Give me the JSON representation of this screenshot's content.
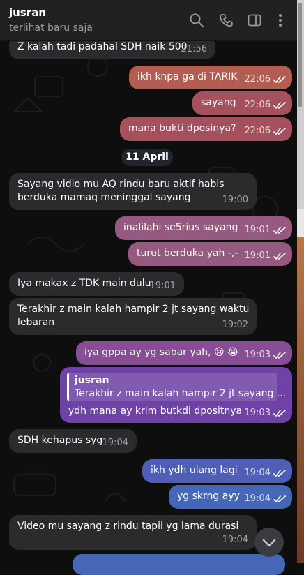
{
  "header": {
    "contact_name": "jusran",
    "status": "terlihat baru saja"
  },
  "date_separator": "11 April",
  "messages": [
    {
      "text": "Z kalah tadi padahal SDH naik 500",
      "time": "21:56",
      "dir": "in"
    },
    {
      "text": "ikh knpa ga di TARIK",
      "time": "22:06",
      "dir": "out"
    },
    {
      "text": "sayang",
      "time": "22:06",
      "dir": "out"
    },
    {
      "text": "mana bukti dposinya?",
      "time": "22:06",
      "dir": "out"
    },
    {
      "text": "Sayang vidio mu AQ rindu baru aktif habis\nberduka mamaq meninggal sayang",
      "time": "19:00",
      "dir": "in"
    },
    {
      "text": "inalilahi se5rius sayang",
      "time": "19:01",
      "dir": "out"
    },
    {
      "text": "turut berduka yah -,-",
      "time": "19:01",
      "dir": "out"
    },
    {
      "text": "Iya makax z TDK main dulu",
      "time": "19:01",
      "dir": "in"
    },
    {
      "text": "Terakhir z main kalah hampir 2 jt sayang waktu\nlebaran",
      "time": "19:02",
      "dir": "in"
    },
    {
      "text": "iya gppa ay yg sabar yah, 😢 😭",
      "time": "19:03",
      "dir": "out"
    },
    {
      "reply_name": "jusran",
      "reply_text": "Terakhir z main kalah hampir 2 jt sayang ...",
      "text": "ydh mana ay krim butkdi dpositnya",
      "time": "19:03",
      "dir": "out"
    },
    {
      "text": "SDH kehapus syg",
      "time": "19:04",
      "dir": "in"
    },
    {
      "text": "ikh ydh ulang lagi",
      "time": "19:04",
      "dir": "out"
    },
    {
      "text": "yg skrng ayy",
      "time": "19:04",
      "dir": "out"
    },
    {
      "text": "Video mu sayang z rindu tapii yg lama durasi",
      "time": "19:04",
      "dir": "in"
    }
  ]
}
